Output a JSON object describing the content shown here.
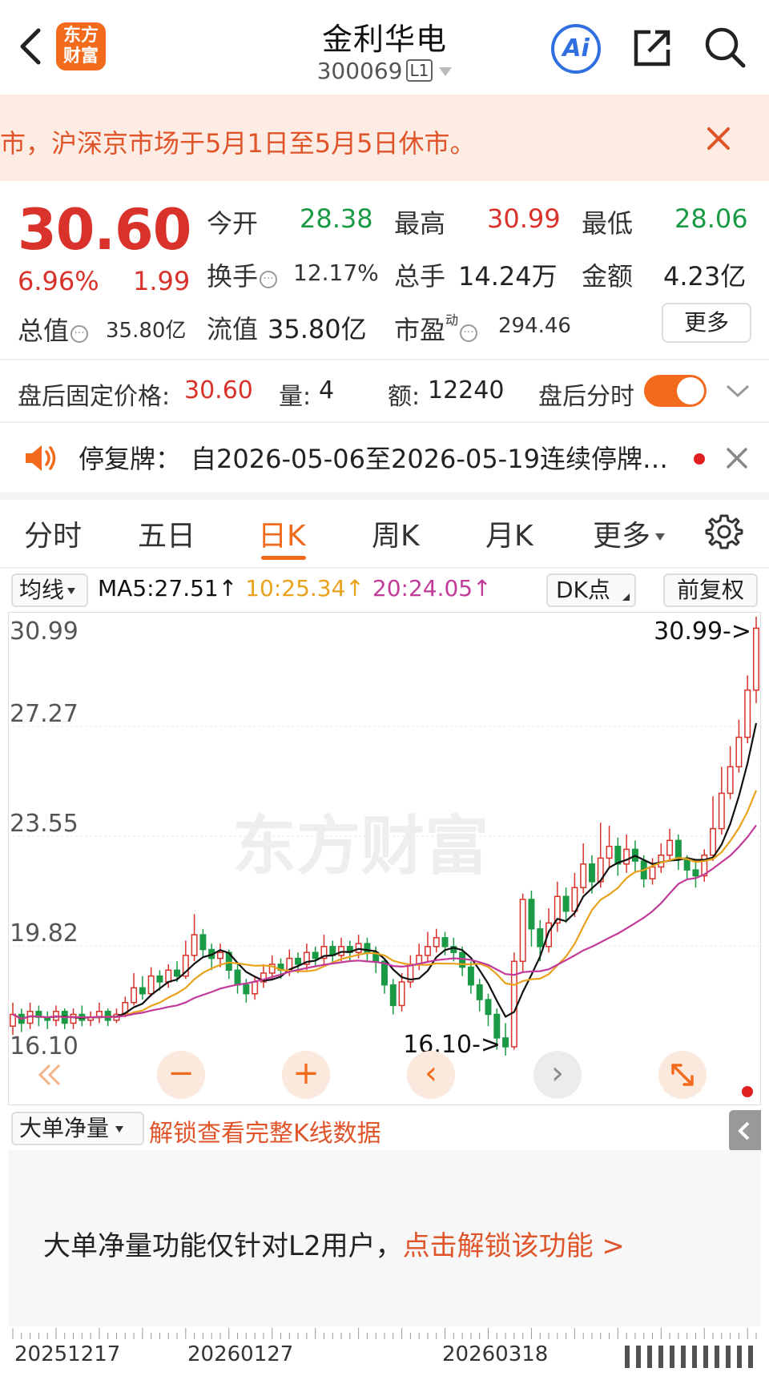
{
  "header": {
    "title": "金利华电",
    "code": "300069",
    "code_badge": "L1",
    "logo_line1": "东方",
    "logo_line2": "财富",
    "ai_label": "Ai"
  },
  "notice": {
    "text": "市，沪深京市场于5月1日至5月5日休市。"
  },
  "quote": {
    "price": "30.60",
    "change_pct": "6.96%",
    "change_amt": "1.99",
    "open_label": "今开",
    "open": "28.38",
    "high_label": "最高",
    "high": "30.99",
    "low_label": "最低",
    "low": "28.06",
    "turnover_label": "换手",
    "turnover": "12.17%",
    "volume_label": "总手",
    "volume": "14.24万",
    "amount_label": "金额",
    "amount": "4.23亿",
    "mktcap_label": "总值",
    "mktcap": "35.80亿",
    "float_label": "流值",
    "float_cap": "35.80亿",
    "pe_label": "市盈",
    "pe_sup": "动",
    "pe": "294.46",
    "more_label": "更多",
    "info_glyph": "···"
  },
  "after_hours": {
    "price_label": "盘后固定价格:",
    "price": "30.60",
    "vol_label": "量:",
    "vol": "4",
    "amt_label": "额:",
    "amt": "12240",
    "toggle_label": "盘后分时"
  },
  "halt_notice": {
    "label": "停复牌：",
    "text": "自2026-05-06至2026-05-19连续停牌…"
  },
  "tabs": [
    "分时",
    "五日",
    "日K",
    "周K",
    "月K",
    "更多"
  ],
  "chart_toolbar": {
    "ma_select": "均线",
    "ma5": "MA5:27.51",
    "ma10": "10:25.34",
    "ma20": "20:24.05",
    "up_arrow": "↑",
    "dk_label": "DK点",
    "adjust_label": "前复权"
  },
  "colors": {
    "up": "#d8322b",
    "down": "#1a9a45",
    "accent": "#f26a1b",
    "ma5": "#111111",
    "ma10": "#e8a21c",
    "ma20": "#c23a9a"
  },
  "chart_data": {
    "type": "candlestick",
    "y_ticks": [
      "30.99",
      "27.27",
      "23.55",
      "19.82",
      "16.10"
    ],
    "ylim": [
      16.1,
      30.99
    ],
    "max_marker": "30.99->",
    "min_marker": "16.10->",
    "x_ticks": [
      "20251217",
      "20260127",
      "20260318"
    ],
    "watermark": "东方财富",
    "candles": [
      [
        17.1,
        17.5,
        17.9,
        16.8
      ],
      [
        17.5,
        17.2,
        17.7,
        16.9
      ],
      [
        17.2,
        17.6,
        17.9,
        17.0
      ],
      [
        17.6,
        17.4,
        17.8,
        17.1
      ],
      [
        17.4,
        17.3,
        17.6,
        17.0
      ],
      [
        17.3,
        17.6,
        17.8,
        17.1
      ],
      [
        17.6,
        17.2,
        17.7,
        17.0
      ],
      [
        17.2,
        17.5,
        17.7,
        17.0
      ],
      [
        17.5,
        17.3,
        17.8,
        17.1
      ],
      [
        17.3,
        17.4,
        17.6,
        17.1
      ],
      [
        17.4,
        17.6,
        17.9,
        17.2
      ],
      [
        17.6,
        17.3,
        17.7,
        17.1
      ],
      [
        17.3,
        17.5,
        17.7,
        17.2
      ],
      [
        17.5,
        17.9,
        18.1,
        17.4
      ],
      [
        17.9,
        18.4,
        18.9,
        17.8
      ],
      [
        18.4,
        18.2,
        18.8,
        18.0
      ],
      [
        18.2,
        18.8,
        19.1,
        18.1
      ],
      [
        18.8,
        18.6,
        19.0,
        18.3
      ],
      [
        18.6,
        19.0,
        19.2,
        18.4
      ],
      [
        19.0,
        18.8,
        19.3,
        18.6
      ],
      [
        18.8,
        19.5,
        20.0,
        18.7
      ],
      [
        19.5,
        20.2,
        20.9,
        19.3
      ],
      [
        20.2,
        19.7,
        20.4,
        19.4
      ],
      [
        19.7,
        19.4,
        19.9,
        19.0
      ],
      [
        19.4,
        19.6,
        19.9,
        19.1
      ],
      [
        19.6,
        19.0,
        19.7,
        18.7
      ],
      [
        19.0,
        18.5,
        19.2,
        18.2
      ],
      [
        18.5,
        18.2,
        18.7,
        17.9
      ],
      [
        18.2,
        18.6,
        18.8,
        18.0
      ],
      [
        18.6,
        18.9,
        19.2,
        18.4
      ],
      [
        18.9,
        19.2,
        19.5,
        18.7
      ],
      [
        19.2,
        19.0,
        19.4,
        18.7
      ],
      [
        19.0,
        19.4,
        19.7,
        18.8
      ],
      [
        19.4,
        19.2,
        19.6,
        18.9
      ],
      [
        19.2,
        19.6,
        19.9,
        19.0
      ],
      [
        19.6,
        19.4,
        19.8,
        19.1
      ],
      [
        19.4,
        19.8,
        20.2,
        19.2
      ],
      [
        19.8,
        19.5,
        20.0,
        19.2
      ],
      [
        19.5,
        19.8,
        20.1,
        19.3
      ],
      [
        19.8,
        19.6,
        20.0,
        19.3
      ],
      [
        19.6,
        19.9,
        20.2,
        19.4
      ],
      [
        19.9,
        19.6,
        20.1,
        19.3
      ],
      [
        19.6,
        19.3,
        19.8,
        18.9
      ],
      [
        19.3,
        18.5,
        19.4,
        18.2
      ],
      [
        18.5,
        17.8,
        18.7,
        17.5
      ],
      [
        17.8,
        18.6,
        18.9,
        17.6
      ],
      [
        18.6,
        19.2,
        19.5,
        18.4
      ],
      [
        19.2,
        19.5,
        19.9,
        19.0
      ],
      [
        19.5,
        19.8,
        20.3,
        19.3
      ],
      [
        19.8,
        20.1,
        20.4,
        19.6
      ],
      [
        20.1,
        19.8,
        20.3,
        19.5
      ],
      [
        19.8,
        19.6,
        20.1,
        19.3
      ],
      [
        19.6,
        19.1,
        19.8,
        18.8
      ],
      [
        19.1,
        18.5,
        19.3,
        18.2
      ],
      [
        18.5,
        18.0,
        18.7,
        17.6
      ],
      [
        18.0,
        17.5,
        18.2,
        17.1
      ],
      [
        17.5,
        16.7,
        17.7,
        16.3
      ],
      [
        16.7,
        16.4,
        17.2,
        16.1
      ],
      [
        16.4,
        19.3,
        19.6,
        16.3
      ],
      [
        19.3,
        21.4,
        21.6,
        18.9
      ],
      [
        21.4,
        20.4,
        21.7,
        19.8
      ],
      [
        20.4,
        19.8,
        20.7,
        19.3
      ],
      [
        19.8,
        20.6,
        21.1,
        19.6
      ],
      [
        20.6,
        21.5,
        22.0,
        20.3
      ],
      [
        21.5,
        21.0,
        21.8,
        20.6
      ],
      [
        21.0,
        21.8,
        22.3,
        20.8
      ],
      [
        21.8,
        22.6,
        23.3,
        21.6
      ],
      [
        22.6,
        22.0,
        22.9,
        21.6
      ],
      [
        22.0,
        22.8,
        24.0,
        21.8
      ],
      [
        22.8,
        23.2,
        23.9,
        22.5
      ],
      [
        23.2,
        22.6,
        23.5,
        22.2
      ],
      [
        22.6,
        23.1,
        23.6,
        22.3
      ],
      [
        23.1,
        22.7,
        23.4,
        22.3
      ],
      [
        22.7,
        22.1,
        22.9,
        21.8
      ],
      [
        22.1,
        22.5,
        22.8,
        21.9
      ],
      [
        22.5,
        22.9,
        23.3,
        22.3
      ],
      [
        22.9,
        23.4,
        23.8,
        22.7
      ],
      [
        23.4,
        22.8,
        23.6,
        22.4
      ],
      [
        22.8,
        22.4,
        22.9,
        22.1
      ],
      [
        22.4,
        22.2,
        22.7,
        21.8
      ],
      [
        22.2,
        22.9,
        23.1,
        22.0
      ],
      [
        22.9,
        23.8,
        24.9,
        22.7
      ],
      [
        23.8,
        25.0,
        25.9,
        23.6
      ],
      [
        25.0,
        25.9,
        26.6,
        24.8
      ],
      [
        25.9,
        26.9,
        27.5,
        25.7
      ],
      [
        26.9,
        28.5,
        29.0,
        26.7
      ],
      [
        28.5,
        30.6,
        30.99,
        28.06
      ]
    ]
  },
  "controls": {
    "zoom_out": "−",
    "zoom_in": "+",
    "prev": "‹",
    "next": "›"
  },
  "indicator": {
    "select_label": "大单净量",
    "unlock_text": "解锁查看完整K线数据",
    "info_text": "大单净量功能仅针对L2用户，",
    "info_link": "点击解锁该功能 >"
  }
}
